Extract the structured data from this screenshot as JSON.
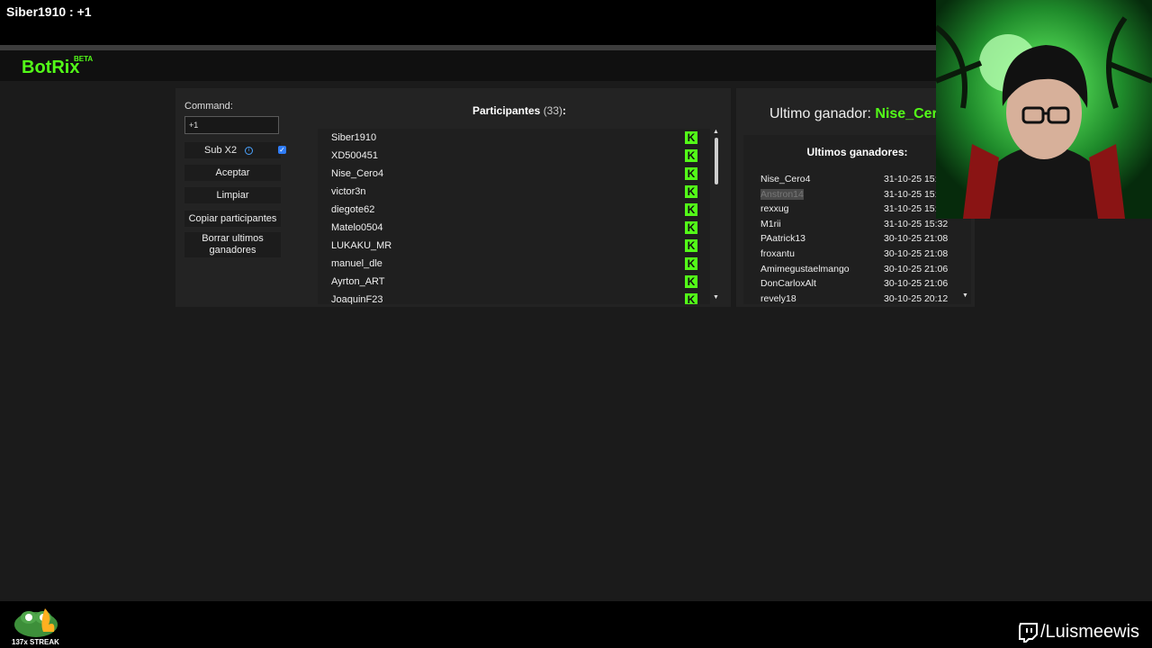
{
  "overlay": {
    "chat_message": "Siber1910 : +1"
  },
  "app": {
    "logo": "BotRix",
    "badge": "BETA"
  },
  "controls": {
    "command_label": "Command:",
    "command_value": "+1",
    "sub_label": "Sub X2",
    "sub_checked": true,
    "accept": "Aceptar",
    "clear": "Limpiar",
    "copy": "Copiar participantes",
    "delete": "Borrar ultimos ganadores"
  },
  "participants": {
    "title": "Participantes",
    "count": "(33)",
    "colon": ":",
    "items": [
      "Siber1910",
      "XD500451",
      "Nise_Cero4",
      "victor3n",
      "diegote62",
      "Matelo0504",
      "LUKAKU_MR",
      "manuel_dle",
      "Ayrton_ART",
      "JoaquinF23"
    ],
    "platform_icon": "kick-icon",
    "platform_color": "#53fc18"
  },
  "last_winner": {
    "label": "Ultimo ganador:",
    "name": "Nise_Cero4"
  },
  "winners": {
    "title": "Ultimos ganadores:",
    "rows": [
      {
        "name": "Nise_Cero4",
        "date": "31-10-25 15:35"
      },
      {
        "name": "Anstron14",
        "date": "31-10-25 15:34"
      },
      {
        "name": "rexxug",
        "date": "31-10-25 15:33"
      },
      {
        "name": "M1rii",
        "date": "31-10-25 15:32"
      },
      {
        "name": "PAatrick13",
        "date": "30-10-25 21:08"
      },
      {
        "name": "froxantu",
        "date": "30-10-25 21:08"
      },
      {
        "name": "Amimegustaelmango",
        "date": "30-10-25 21:06"
      },
      {
        "name": "DonCarloxAlt",
        "date": "30-10-25 21:06"
      },
      {
        "name": "revely18",
        "date": "30-10-25 20:12"
      }
    ]
  },
  "footer": {
    "streak": "137x STREAK",
    "channel": "/Luismeewis"
  }
}
